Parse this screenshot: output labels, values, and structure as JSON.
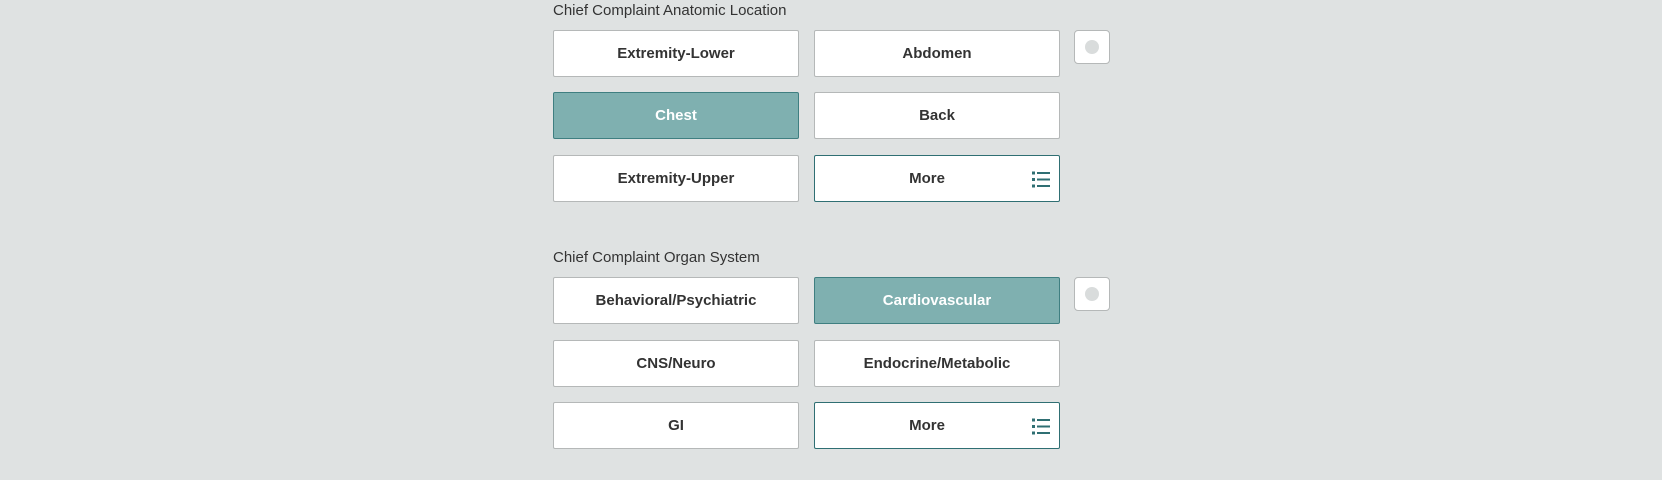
{
  "sections": [
    {
      "title": "Chief Complaint Anatomic Location",
      "options": [
        {
          "label": "Extremity-Lower",
          "selected": false
        },
        {
          "label": "Abdomen",
          "selected": false
        },
        {
          "label": "Chest",
          "selected": true
        },
        {
          "label": "Back",
          "selected": false
        },
        {
          "label": "Extremity-Upper",
          "selected": false
        }
      ],
      "more_label": "More",
      "more_icon": "list-icon",
      "clear_icon": "clear-radio-icon"
    },
    {
      "title": "Chief Complaint Organ System",
      "options": [
        {
          "label": "Behavioral/Psychiatric",
          "selected": false
        },
        {
          "label": "Cardiovascular",
          "selected": true
        },
        {
          "label": "CNS/Neuro",
          "selected": false
        },
        {
          "label": "Endocrine/Metabolic",
          "selected": false
        },
        {
          "label": "GI",
          "selected": false
        }
      ],
      "more_label": "More",
      "more_icon": "list-icon",
      "clear_icon": "clear-radio-icon"
    }
  ],
  "colors": {
    "background": "#dfe2e2",
    "selected_fill": "#7fb0b0",
    "accent": "#2f6f73"
  }
}
